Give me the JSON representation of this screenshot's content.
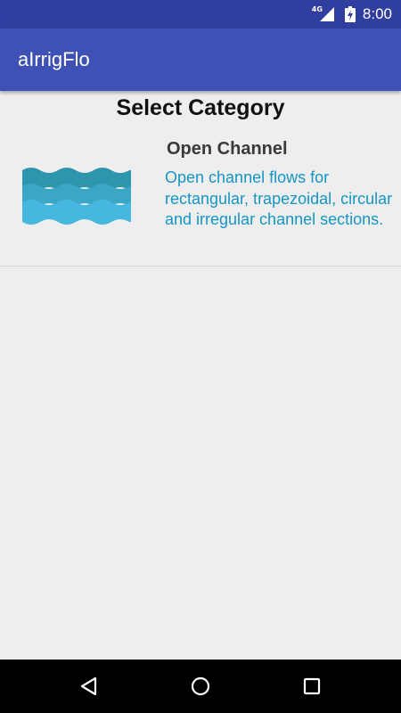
{
  "status_bar": {
    "network": "4G",
    "time": "8:00",
    "icons": [
      "signal-icon",
      "battery-charging-icon"
    ]
  },
  "app_bar": {
    "title": "aIrrigFlo"
  },
  "main": {
    "title": "Select Category",
    "categories": [
      {
        "name": "Open Channel",
        "description": "Open channel flows for rectangular, trapezoidal, circular and irregular channel sections.",
        "icon": "water-waves-icon"
      }
    ]
  },
  "nav_bar": {
    "icons": [
      "back-icon",
      "home-icon",
      "recents-icon"
    ]
  },
  "colors": {
    "status_bar": "#303f9f",
    "app_bar": "#3f51b5",
    "background": "#eeeeee",
    "description_text": "#1596c4",
    "wave_dark": "#2d95ad",
    "wave_mid": "#3aa7c7",
    "wave_light": "#46b8df"
  }
}
